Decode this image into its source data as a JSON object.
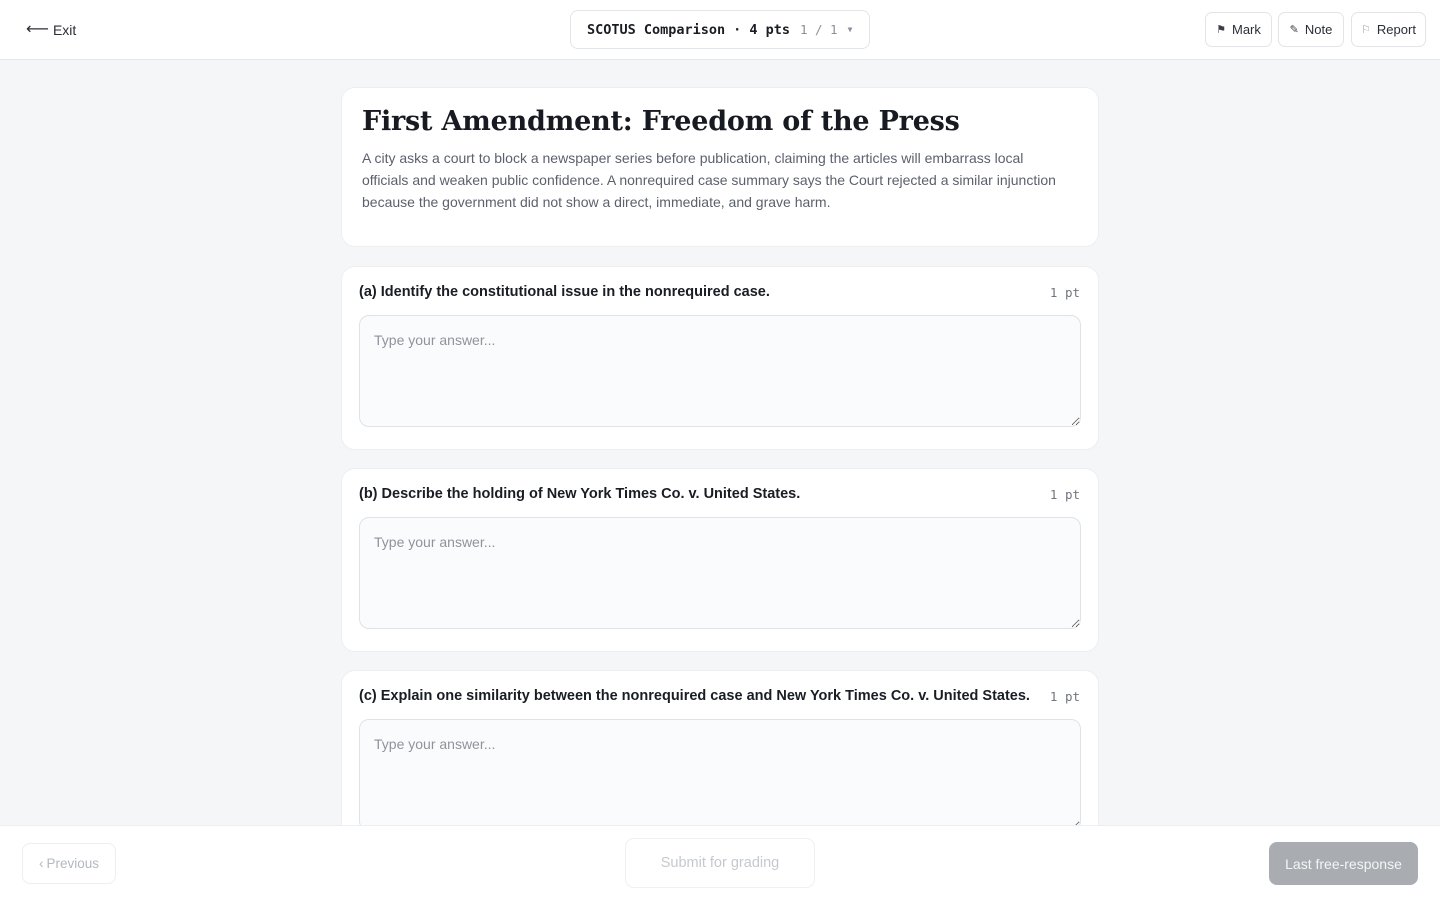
{
  "header": {
    "exit_label": "Exit",
    "exit_icon": "arrow-left-icon",
    "title": "SCOTUS Comparison",
    "separator": "·",
    "points": "4 pts",
    "counter": "1 / 1",
    "caret_icon": "chevron-down-icon",
    "mark_label": "Mark",
    "mark_icon": "flag-icon",
    "note_label": "Note",
    "note_icon": "pencil-icon",
    "report_label": "Report",
    "report_icon": "flag-outline-icon"
  },
  "intro": {
    "title": "First Amendment: Freedom of the Press",
    "description": "A city asks a court to block a newspaper series before publication, claiming the articles will embarrass local officials and weaken public confidence. A nonrequired case summary says the Court rejected a similar injunction because the government did not show a direct, immediate, and grave harm."
  },
  "questions": [
    {
      "prompt": "(a) Identify the constitutional issue in the nonrequired case.",
      "points": "1 pt",
      "value": "",
      "placeholder": "Type your answer..."
    },
    {
      "prompt": "(b) Describe the holding of New York Times Co. v. United States.",
      "points": "1 pt",
      "value": "",
      "placeholder": "Type your answer..."
    },
    {
      "prompt": "(c) Explain one similarity between the nonrequired case and New York Times Co. v. United States.",
      "points": "1 pt",
      "value": "",
      "placeholder": "Type your answer..."
    }
  ],
  "footer": {
    "previous_label": "Previous",
    "previous_icon": "chevron-left-icon",
    "submit_label": "Submit for grading",
    "last_label": "Last free-response"
  },
  "colors": {
    "background": "#f5f6f8",
    "card": "#ffffff",
    "disabled_button": "#a9acb1"
  }
}
